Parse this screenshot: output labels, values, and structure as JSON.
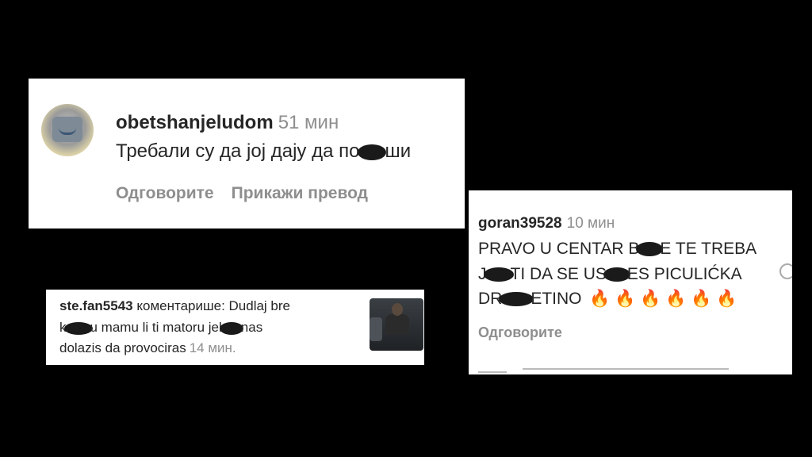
{
  "card1": {
    "username": "obetshanjeludom",
    "time": "51 мин",
    "comment_before": "Требали су да јој дају да по",
    "comment_after": "ши",
    "reply": "Одговорите",
    "translate": "Прикажи превод"
  },
  "card2": {
    "username": "goran39528",
    "time": "10 мин",
    "line1_a": "PRAVO U CENTAR B",
    "line1_b": "E TE TREBA",
    "line2_a": "J",
    "line2_b": "TI DA SE US",
    "line2_c": "ES PICULIĆKA",
    "line3_a": "DR",
    "line3_b": "ETINO",
    "emojis": "🔥 🔥 🔥 🔥 🔥 🔥",
    "reply": "Одговорите"
  },
  "card3": {
    "username": "ste.fan5543",
    "line1_rest": "коментарише: Dudlaj bre",
    "line2_a": "k",
    "line2_b": "u mamu li ti matoru jel",
    "line2_c": "nas",
    "line3": "dolazis da provociras",
    "time": "14 мин."
  },
  "colors": {
    "background": "#000000",
    "card": "#ffffff",
    "muted": "#8e8e8e",
    "text": "#262626",
    "redaction": "#1a1a1a"
  }
}
